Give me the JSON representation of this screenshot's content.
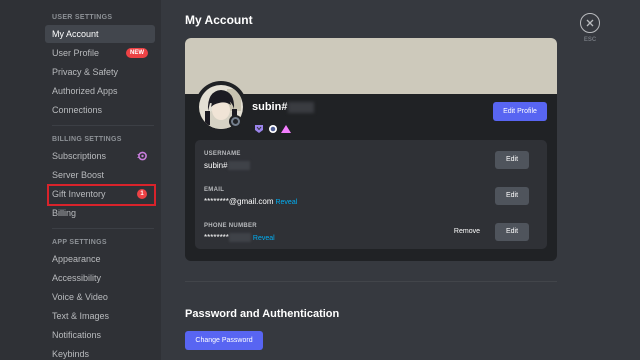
{
  "sidebar": {
    "user_settings_header": "USER SETTINGS",
    "user_items": [
      {
        "label": "My Account"
      },
      {
        "label": "User Profile",
        "badge": "NEW"
      },
      {
        "label": "Privacy & Safety"
      },
      {
        "label": "Authorized Apps"
      },
      {
        "label": "Connections"
      }
    ],
    "billing_header": "BILLING SETTINGS",
    "billing_items": [
      {
        "label": "Subscriptions"
      },
      {
        "label": "Server Boost"
      },
      {
        "label": "Gift Inventory",
        "badge": "1"
      },
      {
        "label": "Billing"
      }
    ],
    "app_header": "APP SETTINGS",
    "app_items": [
      {
        "label": "Appearance"
      },
      {
        "label": "Accessibility"
      },
      {
        "label": "Voice & Video"
      },
      {
        "label": "Text & Images"
      },
      {
        "label": "Notifications"
      },
      {
        "label": "Keybinds"
      }
    ]
  },
  "main": {
    "title": "My Account",
    "profile": {
      "username": "subin#",
      "edit_profile_label": "Edit Profile"
    },
    "fields": {
      "username": {
        "label": "USERNAME",
        "value": "subin#",
        "edit_label": "Edit"
      },
      "email": {
        "label": "EMAIL",
        "value": "********@gmail.com",
        "reveal_label": "Reveal",
        "edit_label": "Edit"
      },
      "phone": {
        "label": "PHONE NUMBER",
        "value": "********",
        "reveal_label": "Reveal",
        "remove_label": "Remove",
        "edit_label": "Edit"
      }
    },
    "password_section": {
      "title": "Password and Authentication",
      "change_password_label": "Change Password"
    }
  },
  "close": {
    "esc_label": "ESC"
  },
  "colors": {
    "accent": "#5865f2",
    "danger": "#ed4245",
    "link": "#00aff4",
    "highlight_box": "#d9232b"
  }
}
